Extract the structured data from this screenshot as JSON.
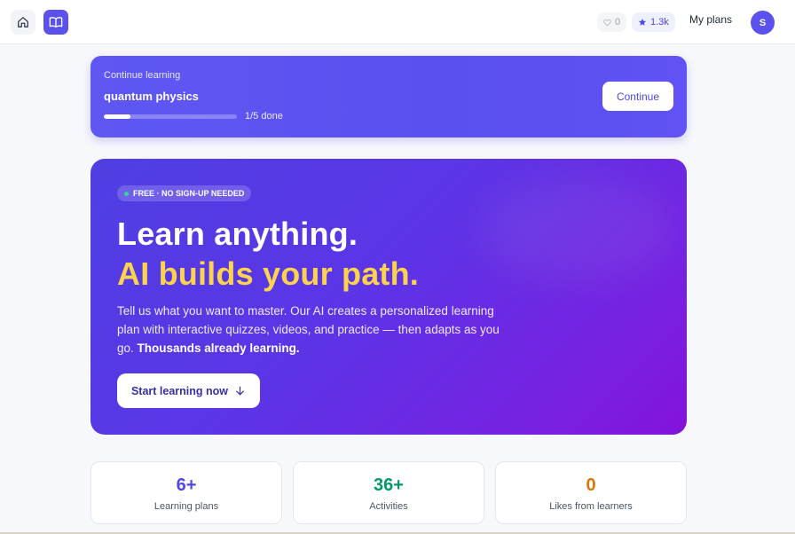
{
  "topbar": {
    "likes_count": "0",
    "stars_count": "1.3k",
    "my_plans_label": "My plans",
    "avatar_initial": "S"
  },
  "continue_card": {
    "kicker": "Continue learning",
    "title": "quantum physics",
    "progress_fraction": 0.2,
    "progress_text": "1/5 done",
    "button_label": "Continue"
  },
  "hero": {
    "badge": "FREE · NO SIGN-UP NEEDED",
    "headline_line1": "Learn anything.",
    "headline_line2": "AI builds your path.",
    "body": "Tell us what you want to master. Our AI creates a personalized learning plan with interactive quizzes, videos, and practice — then adapts as you go.",
    "body_emphasis": "Thousands already learning.",
    "cta_label": "Start learning now"
  },
  "stats": [
    {
      "value": "6+",
      "label": "Learning plans",
      "color": "#4f46e5"
    },
    {
      "value": "36+",
      "label": "Activities",
      "color": "#059669"
    },
    {
      "value": "0",
      "label": "Likes from learners",
      "color": "#d97706"
    }
  ],
  "colors": {
    "accent": "#5b51ee",
    "headline_highlight": "#fcd34d"
  },
  "icons": {
    "home": "home-icon",
    "book": "book-open-icon",
    "likes": "heart-icon",
    "stars": "star-icon",
    "cta_arrow": "arrow-down-icon"
  }
}
